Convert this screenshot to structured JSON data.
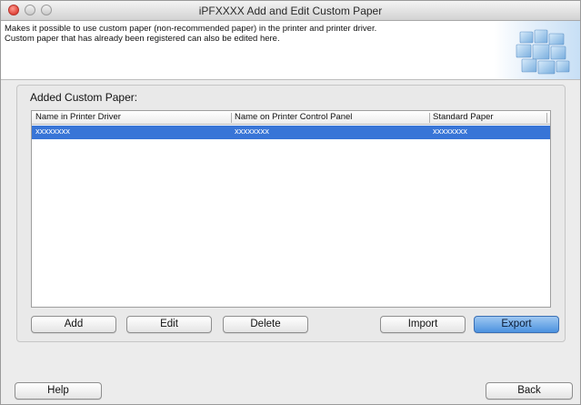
{
  "window": {
    "title": "iPFXXXX Add and Edit Custom Paper"
  },
  "banner": {
    "line1": "Makes it possible to use custom paper (non-recommended paper) in the printer and printer driver.",
    "line2": "Custom paper that has already been registered can also be edited here."
  },
  "group": {
    "label": "Added Custom Paper:"
  },
  "table": {
    "columns": [
      "Name in Printer Driver",
      "Name on Printer Control Panel",
      "Standard Paper"
    ],
    "rows": [
      {
        "driver_name": "xxxxxxxx",
        "panel_name": "xxxxxxxx",
        "standard_paper": "xxxxxxxx",
        "selected": true
      }
    ]
  },
  "buttons": {
    "add": "Add",
    "edit": "Edit",
    "delete": "Delete",
    "import": "Import",
    "export": "Export",
    "help": "Help",
    "back": "Back"
  },
  "colors": {
    "selection": "#3875d7",
    "default_button": "#4c92df"
  },
  "icons": {
    "banner_art": "printer-paper-icon"
  }
}
